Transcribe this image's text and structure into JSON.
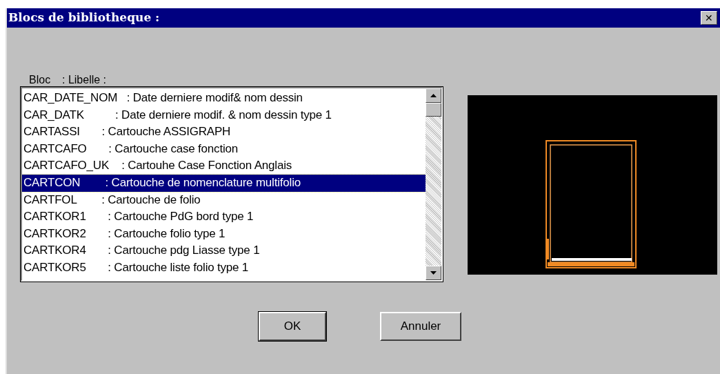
{
  "window": {
    "title": "Blocs de bibliotheque :",
    "close": "✕"
  },
  "list": {
    "header_bloc": "Bloc",
    "header_libelle": ": Libelle :",
    "rows": [
      {
        "text": "CAR_DATE_NOM   : Date derniere modif& nom dessin",
        "selected": false
      },
      {
        "text": "CAR_DATK          : Date derniere modif. & nom dessin type 1",
        "selected": false
      },
      {
        "text": "CARTASSI       : Cartouche ASSIGRAPH",
        "selected": false
      },
      {
        "text": "CARTCAFO       : Cartouche case fonction",
        "selected": false
      },
      {
        "text": "CARTCAFO_UK    : Cartouhe Case Fonction Anglais",
        "selected": false
      },
      {
        "text": "CARTCON        : Cartouche de nomenclature multifolio",
        "selected": true
      },
      {
        "text": "CARTFOL        : Cartouche de folio",
        "selected": false
      },
      {
        "text": "CARTKOR1       : Cartouche PdG bord type 1",
        "selected": false
      },
      {
        "text": "CARTKOR2       : Cartouche folio type 1",
        "selected": false
      },
      {
        "text": "CARTKOR4       : Cartouche pdg Liasse type 1",
        "selected": false
      },
      {
        "text": "CARTKOR5       : Cartouche liste folio type 1",
        "selected": false
      }
    ]
  },
  "buttons": [
    {
      "label": "OK",
      "kind": "default"
    },
    {
      "label": "Annuler",
      "kind": "normal"
    }
  ]
}
